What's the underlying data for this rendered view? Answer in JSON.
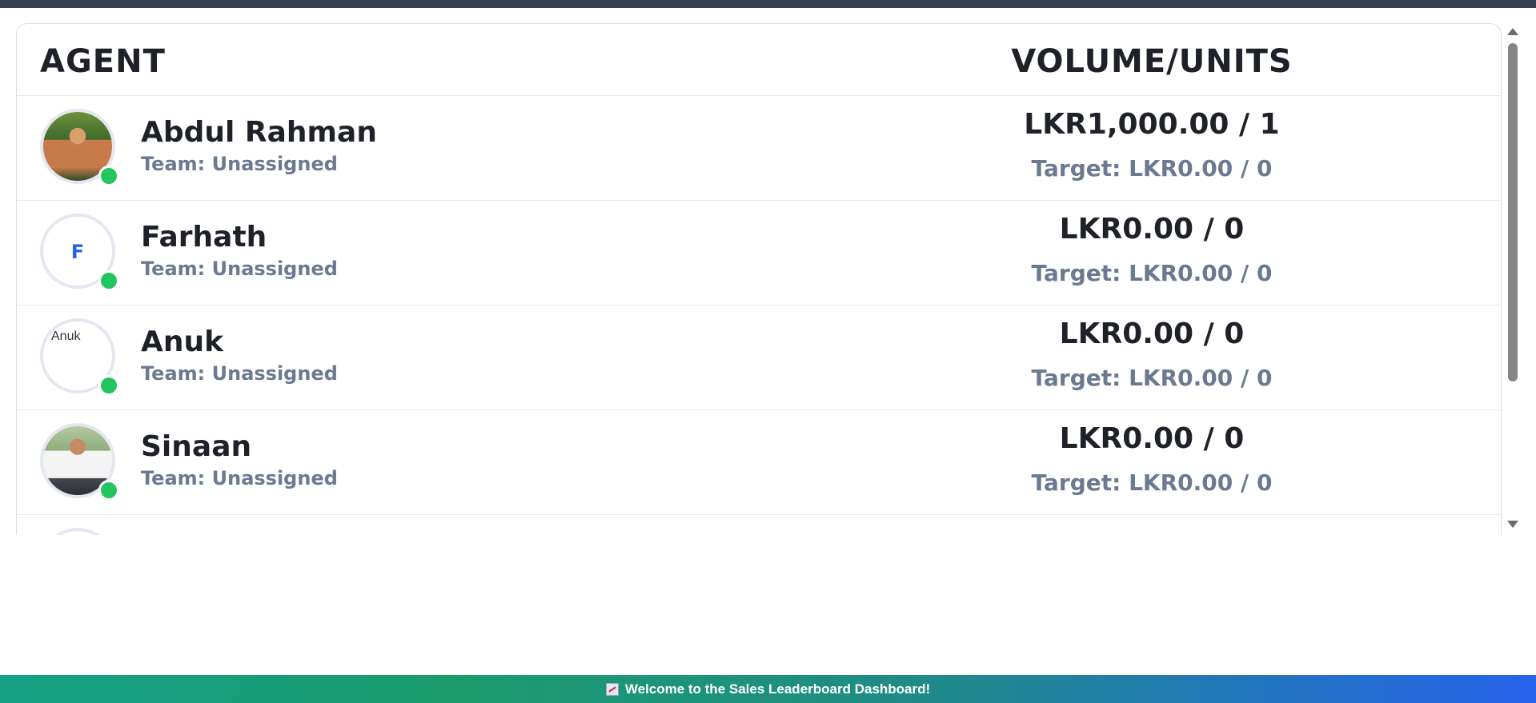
{
  "header": {
    "agent": "AGENT",
    "volume_units": "VOLUME/UNITS"
  },
  "rows": [
    {
      "name": "Abdul Rahman",
      "team": "Team: Unassigned",
      "volume": "LKR1,000.00 / 1",
      "target": "Target: LKR0.00 / 0",
      "avatar": "photo"
    },
    {
      "name": "Farhath",
      "team": "Team: Unassigned",
      "volume": "LKR0.00 / 0",
      "target": "Target: LKR0.00 / 0",
      "avatar": "initial",
      "initial": "F"
    },
    {
      "name": "Anuk",
      "team": "Team: Unassigned",
      "volume": "LKR0.00 / 0",
      "target": "Target: LKR0.00 / 0",
      "avatar": "broken-image",
      "alt": "Anuk"
    },
    {
      "name": "Sinaan",
      "team": "Team: Unassigned",
      "volume": "LKR0.00 / 0",
      "target": "Target: LKR0.00 / 0",
      "avatar": "photo"
    }
  ],
  "status_color": "#22c55e",
  "footer": {
    "icon": "chart-increasing-icon",
    "message": "Welcome to the Sales Leaderboard Dashboard!"
  }
}
